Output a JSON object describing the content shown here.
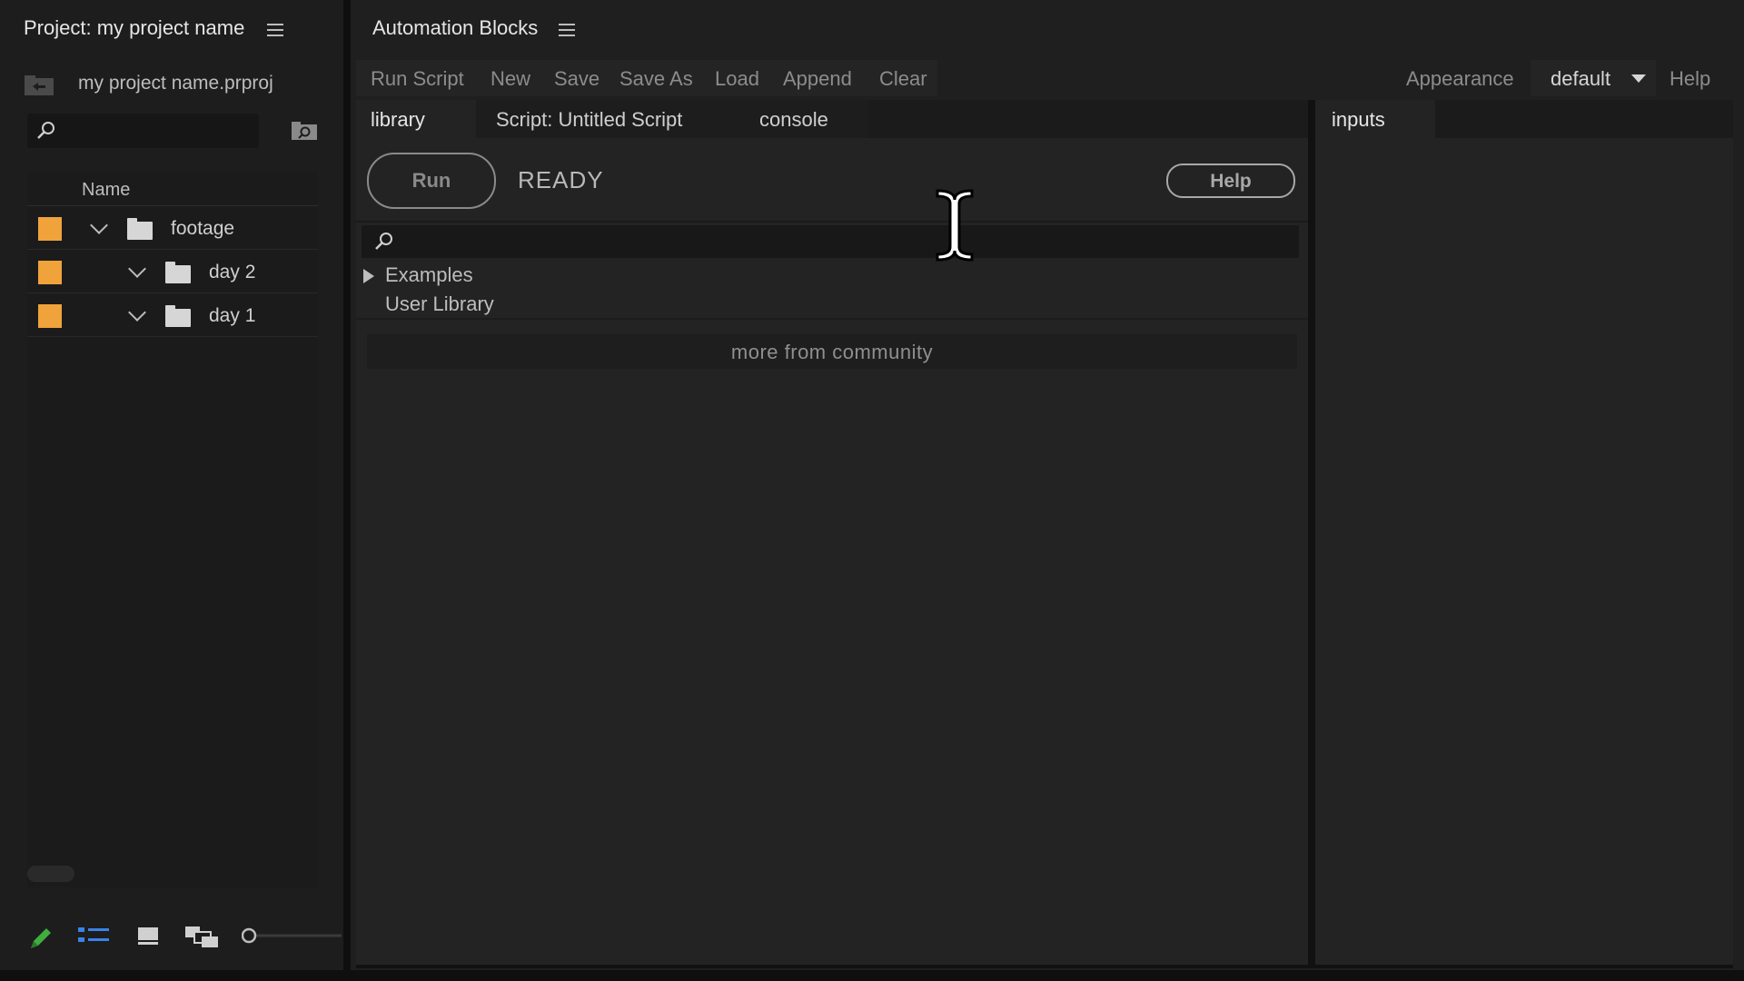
{
  "project_panel": {
    "title": "Project: my project name",
    "file_name": "my project name.prproj",
    "column_name": "Name",
    "items": [
      {
        "label": "footage",
        "label_color": "#f0a33b"
      },
      {
        "label": "day 2",
        "label_color": "#f0a33b"
      },
      {
        "label": "day 1",
        "label_color": "#f0a33b"
      }
    ],
    "bottom_icons": [
      "pencil-icon",
      "list-view-icon",
      "icon-view-icon",
      "freeform-view-icon",
      "zoom-slider"
    ]
  },
  "automation_blocks": {
    "title": "Automation Blocks",
    "toolbar": {
      "run_script": "Run Script",
      "new": "New",
      "save": "Save",
      "save_as": "Save As",
      "load": "Load",
      "append": "Append",
      "clear": "Clear",
      "appearance": "Appearance",
      "appearance_value": "default",
      "help": "Help"
    },
    "tabs": {
      "library": "library",
      "script": "Script: Untitled Script",
      "console": "console",
      "inputs": "inputs"
    },
    "run_button": "Run",
    "status": "READY",
    "help_button": "Help",
    "library": {
      "examples": "Examples",
      "user_library": "User Library",
      "more_from_community": "more from community"
    }
  },
  "colors": {
    "accent_orange": "#f0a33b",
    "panel_bg": "#232323",
    "text_muted": "#8c8c8c"
  }
}
